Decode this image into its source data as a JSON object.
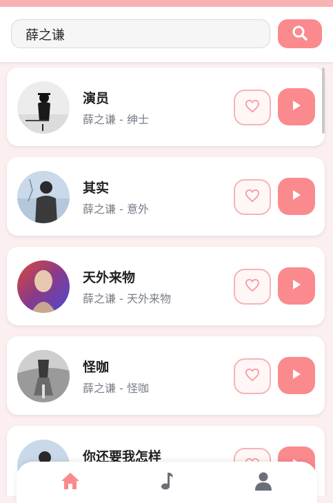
{
  "search": {
    "value": "薛之谦",
    "icon": "search-icon"
  },
  "colors": {
    "accent": "#fa8a8e",
    "like_border": "#f6b3b6",
    "top_strip": "#f7b3b3",
    "background": "#fbeff0"
  },
  "songs": [
    {
      "title": "演员",
      "subtitle": "薛之谦 - 绅士"
    },
    {
      "title": "其实",
      "subtitle": "薛之谦 - 意外"
    },
    {
      "title": "天外来物",
      "subtitle": "薛之谦 - 天外来物"
    },
    {
      "title": "怪咖",
      "subtitle": "薛之谦 - 怪咖"
    },
    {
      "title": "你还要我怎样",
      "subtitle": ""
    }
  ],
  "bottom_nav": {
    "items": [
      {
        "icon": "home-icon",
        "active": true
      },
      {
        "icon": "music-note-icon",
        "active": false
      },
      {
        "icon": "user-icon",
        "active": false
      }
    ]
  }
}
